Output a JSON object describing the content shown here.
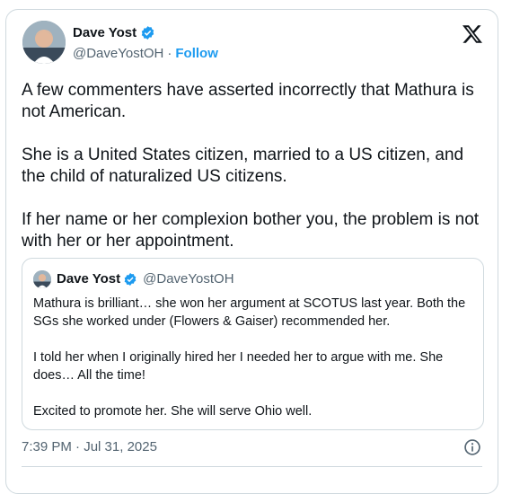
{
  "author": {
    "name": "Dave Yost",
    "handle": "@DaveYostOH",
    "separator": "·",
    "follow_label": "Follow"
  },
  "tweet": {
    "paragraphs": [
      "A few commenters have asserted incorrectly that Mathura is not American.",
      "She is a United States citizen, married to a US citizen, and the child of naturalized US citizens.",
      "If her name or her complexion bother you, the problem is not with her or her appointment."
    ]
  },
  "quoted_tweet": {
    "name": "Dave Yost",
    "handle": "@DaveYostOH",
    "paragraphs": [
      "Mathura is brilliant… she won her argument at SCOTUS last year.  Both the SGs she worked under (Flowers & Gaiser) recommended her.",
      "I told her when I originally hired her I needed her to argue with me. She does… All the time!",
      "Excited to promote her.  She will serve Ohio well."
    ]
  },
  "meta": {
    "time": "7:39 PM",
    "separator": " · ",
    "date": "Jul 31, 2025"
  },
  "icons": {
    "brand": "x-logo-icon",
    "verified": "verified-badge-icon",
    "info": "info-icon"
  },
  "colors": {
    "accent": "#1d9bf0",
    "text": "#0f1419",
    "secondary": "#536471",
    "border": "#cfd9de"
  }
}
